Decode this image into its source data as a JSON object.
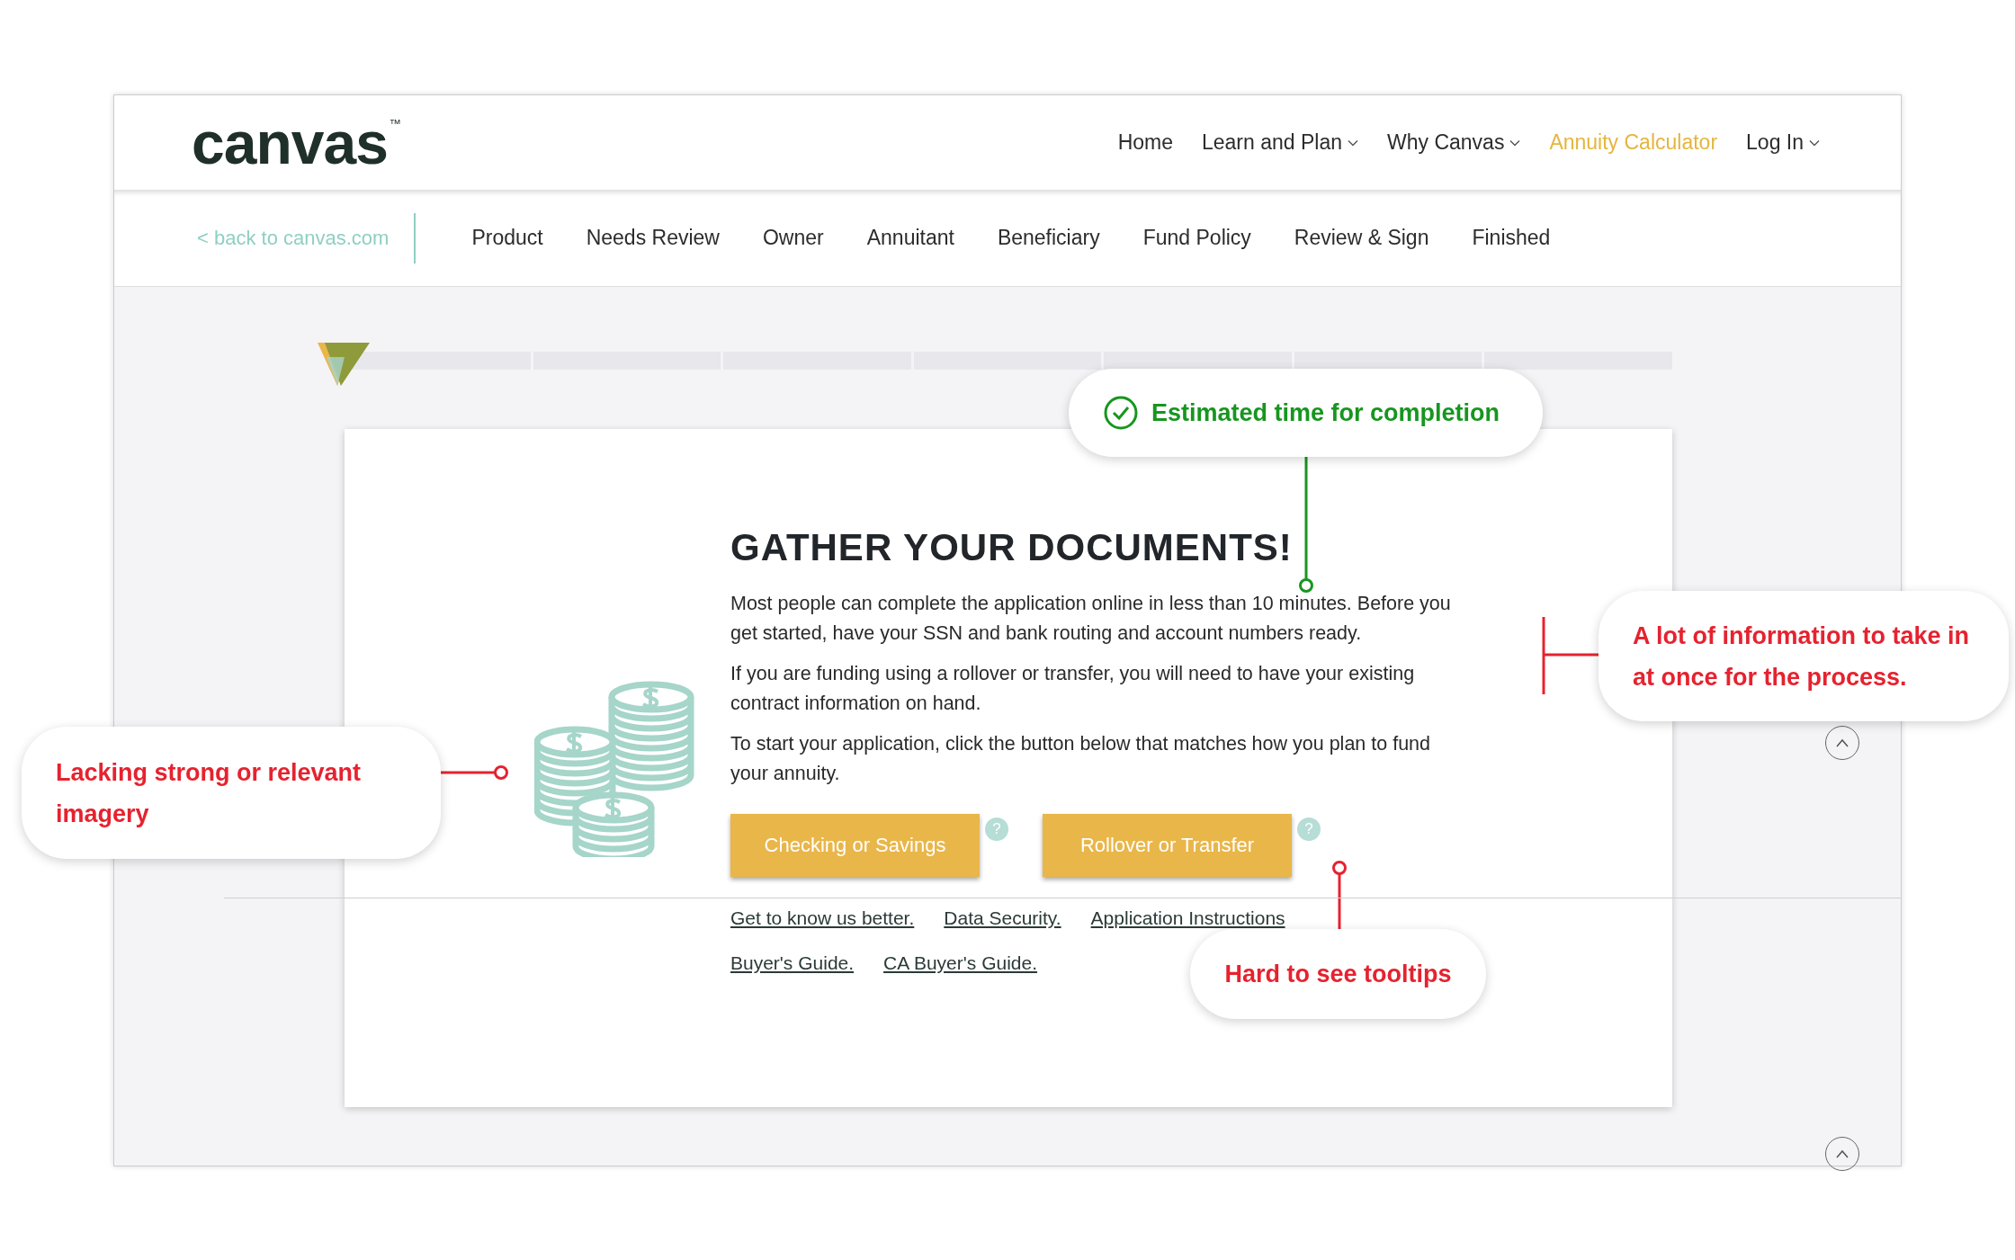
{
  "header": {
    "logo": {
      "text": "canvas",
      "trademark": "™"
    },
    "nav": [
      {
        "label": "Home",
        "dropdown": false,
        "selected": false
      },
      {
        "label": "Learn and Plan",
        "dropdown": true,
        "selected": false
      },
      {
        "label": "Why Canvas",
        "dropdown": true,
        "selected": false
      },
      {
        "label": "Annuity Calculator",
        "dropdown": false,
        "selected": true
      },
      {
        "label": "Log In",
        "dropdown": true,
        "selected": false
      }
    ]
  },
  "steps_bar": {
    "back_link": "< back to canvas.com",
    "steps": [
      {
        "label": "Product",
        "selected": false
      },
      {
        "label": "Needs Review",
        "selected": false
      },
      {
        "label": "Owner",
        "selected": false
      },
      {
        "label": "Annuitant",
        "selected": false
      },
      {
        "label": "Beneficiary",
        "selected": false
      },
      {
        "label": "Fund Policy",
        "selected": false
      },
      {
        "label": "Review & Sign",
        "selected": false
      },
      {
        "label": "Finished",
        "selected": false
      }
    ]
  },
  "card": {
    "heading": "GATHER YOUR DOCUMENTS!",
    "paragraphs": [
      "Most people can complete the application online in less than 10 minutes. Before you get started, have your SSN and bank routing and account numbers ready.",
      "If you are funding using a rollover or transfer, you will need to have your existing contract information on hand.",
      "To start your application, click the button below that matches how you plan to fund your annuity."
    ],
    "buttons": [
      {
        "label": "Checking or Savings",
        "help": "?"
      },
      {
        "label": "Rollover or Transfer",
        "help": "?"
      }
    ],
    "links": [
      [
        "Get to know us better.",
        "Data Security.",
        "Application Instructions"
      ],
      [
        "Buyer's Guide.",
        "CA Buyer's Guide."
      ]
    ]
  },
  "annotations": [
    {
      "text": "Estimated time for completion",
      "color": "#17961f",
      "kind": "check"
    },
    {
      "text": "A lot of information to take in at once for the process.",
      "color": "#e6222f",
      "kind": "bracket"
    },
    {
      "text": "Lacking strong or relevant imagery",
      "color": "#e6222f",
      "kind": "pointer"
    },
    {
      "text": "Hard to see tooltips",
      "color": "#e6222f",
      "kind": "pointer"
    }
  ]
}
